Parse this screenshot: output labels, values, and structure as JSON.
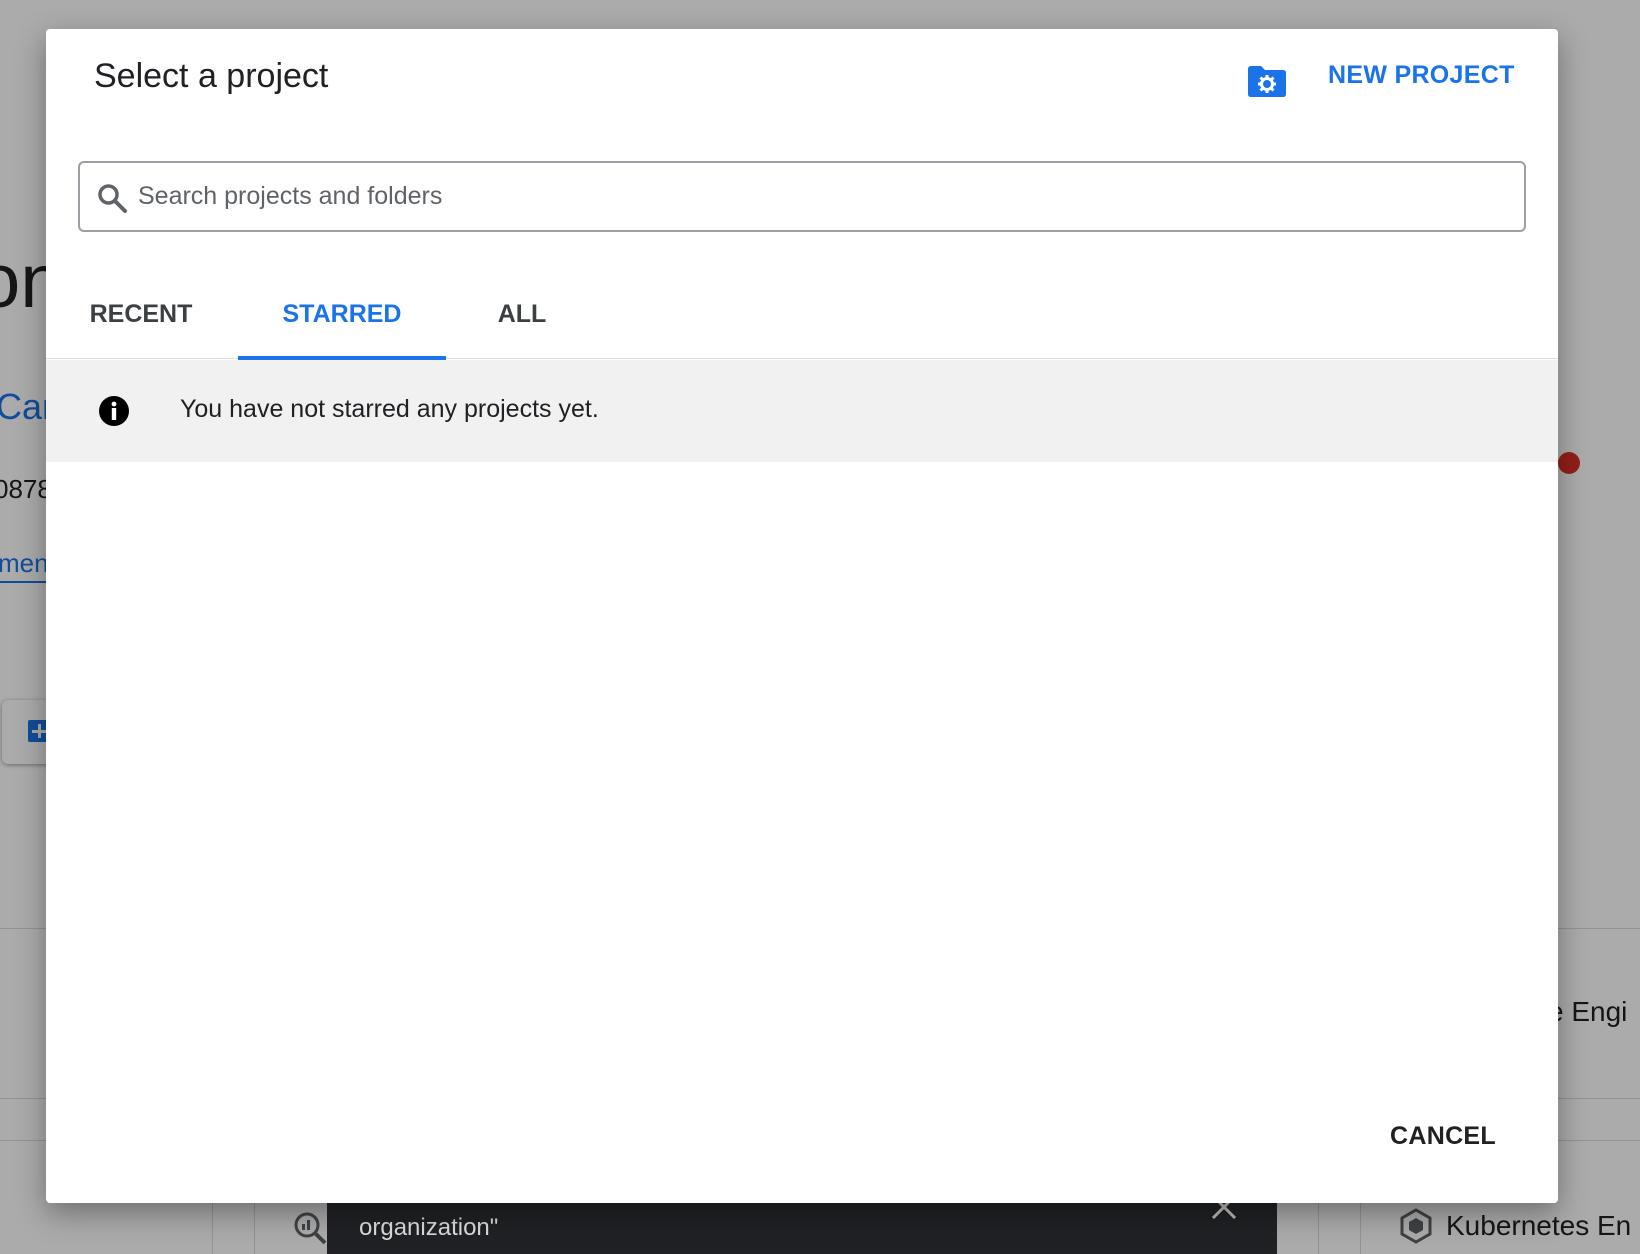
{
  "background": {
    "heading_fragment": "on",
    "link_fragment": "Car",
    "number_fragment": "0878",
    "underlined_link_fragment": "mend",
    "engine_fragment": "e Engi",
    "kubernetes_fragment": "Kubernetes En",
    "snackbar_text": "organization\""
  },
  "dialog": {
    "title": "Select a project",
    "new_project_label": "NEW PROJECT",
    "search": {
      "placeholder": "Search projects and folders",
      "value": ""
    },
    "tabs": [
      {
        "label": "RECENT",
        "selected": false
      },
      {
        "label": "STARRED",
        "selected": true
      },
      {
        "label": "ALL",
        "selected": false
      }
    ],
    "empty_message": "You have not starred any projects yet.",
    "cancel_label": "CANCEL"
  },
  "colors": {
    "accent": "#1a73e8",
    "notice_bg": "#f1f1f1",
    "scrim": "#000000",
    "snackbar": "#202124"
  },
  "icons": {
    "new_project": "folder-gear-icon",
    "search": "search-icon",
    "info": "info-icon",
    "snackbar_close": "close-icon"
  }
}
